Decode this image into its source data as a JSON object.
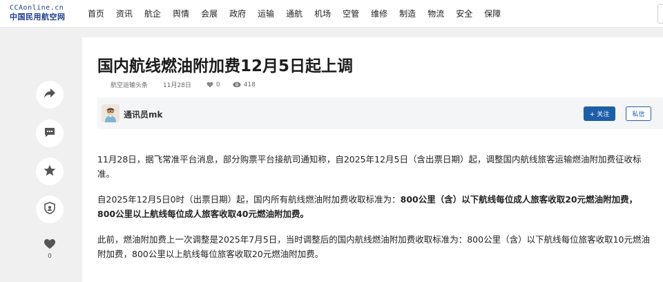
{
  "header": {
    "logo_top": "CCAonline.cn",
    "logo_bottom": "中国民用航空网",
    "nav": [
      "首页",
      "资讯",
      "航企",
      "舆情",
      "会展",
      "政府",
      "运输",
      "通航",
      "机场",
      "空管",
      "维修",
      "制造",
      "物流",
      "安全",
      "保障"
    ]
  },
  "rail": {
    "like_count": "0",
    "icons": [
      "share-icon",
      "comment-icon",
      "star-icon",
      "report-icon",
      "heart-icon"
    ]
  },
  "article": {
    "title": "国内航线燃油附加费12月5日起上调",
    "source": "航空运输头条",
    "date": "11月28日",
    "likes": "0",
    "views": "418",
    "author": "通讯员mk",
    "follow_label": "+ 关注",
    "dm_label": "私信",
    "p1": "11月28日，据飞常准平台消息，部分购票平台接航司通知称，自2025年12月5日（含出票日期）起，调整国内航线旅客运输燃油附加费征收标准。",
    "p2_plain": "自2025年12月5日0时（出票日期）起，国内所有航线燃油附加费收取标准为：",
    "p2_bold": "800公里（含）以下航线每位成人旅客收取20元燃油附加费，800公里以上航线每位成人旅客收取40元燃油附加费。",
    "p3": "此前，燃油附加费上一次调整是2025年7月5日，当时调整后的国内航线燃油附加费收取标准为：800公里（含）以下航线每位旅客收取10元燃油附加费，800公里以上航线每位旅客收取20元燃油附加费。"
  },
  "colors": {
    "brand": "#1d3f8f",
    "accent": "#1d5ea8",
    "background": "#f0f0f0"
  }
}
